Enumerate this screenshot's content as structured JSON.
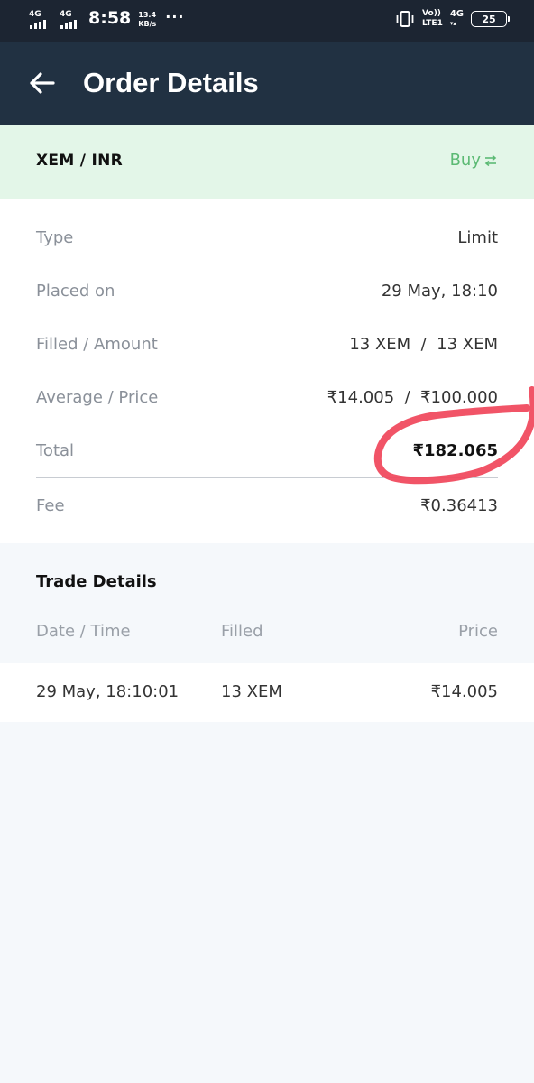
{
  "status_bar": {
    "network1": "4G",
    "network2": "4G",
    "time": "8:58",
    "speed_value": "13.4",
    "speed_unit": "KB/s",
    "more": "···",
    "volte_top": "Vo))",
    "volte_bottom": "LTE1",
    "network3": "4G",
    "battery": "25"
  },
  "toolbar": {
    "title": "Order Details",
    "back_icon": "arrow-left-icon"
  },
  "pair_header": {
    "pair": "XEM / INR",
    "side": "Buy",
    "side_icon": "swap-arrows-icon",
    "side_color": "#5cba74"
  },
  "details": {
    "rows": [
      {
        "label": "Type",
        "value": "Limit"
      },
      {
        "label": "Placed on",
        "value": "29 May, 18:10"
      },
      {
        "label": "Filled / Amount",
        "value": "13 XEM  /  13 XEM"
      },
      {
        "label": "Average / Price",
        "value": "₹14.005  /  ₹100.000"
      },
      {
        "label": "Total",
        "value": "₹182.065"
      },
      {
        "label": "Fee",
        "value": "₹0.36413"
      }
    ]
  },
  "trade_details": {
    "title": "Trade Details",
    "headers": [
      "Date / Time",
      "Filled",
      "Price"
    ],
    "rows": [
      {
        "datetime": "29 May, 18:10:01",
        "filled": "13 XEM",
        "price": "₹14.005"
      }
    ]
  },
  "colors": {
    "toolbar_bg": "#213142",
    "pair_header_bg": "#e3f6e8",
    "annotation": "#f0455a"
  }
}
